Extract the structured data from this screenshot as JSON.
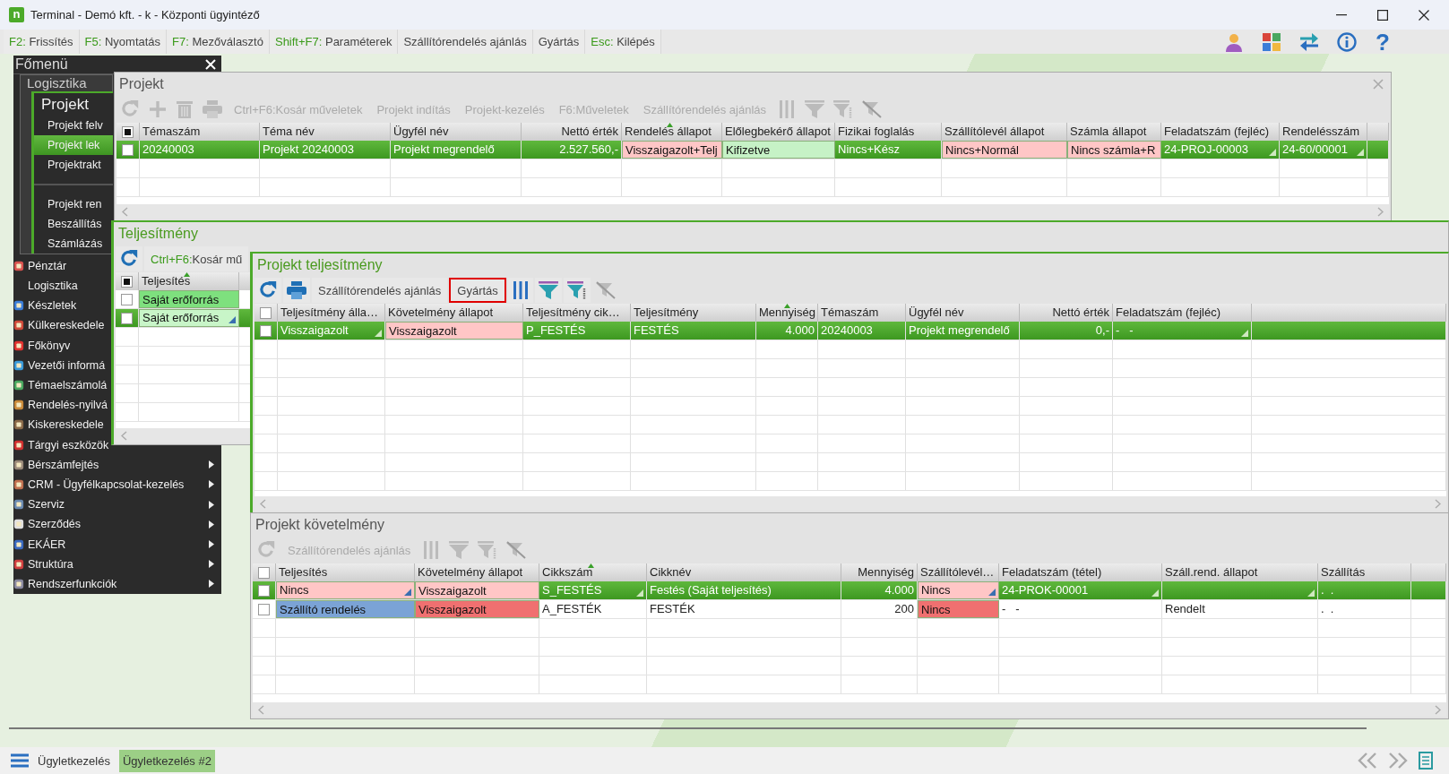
{
  "window": {
    "logo": "n",
    "title": "Terminal - Demó kft. - k - Központi ügyintéző"
  },
  "function_bar": [
    {
      "key": "F2:",
      "label": "Frissítés"
    },
    {
      "key": "F5:",
      "label": "Nyomtatás"
    },
    {
      "key": "F7:",
      "label": "Mezőválasztó"
    },
    {
      "key": "Shift+F7:",
      "label": "Paraméterek"
    },
    {
      "label": "Szállítórendelés ajánlás"
    },
    {
      "label": "Gyártás"
    },
    {
      "key": "Esc:",
      "label": "Kilépés"
    }
  ],
  "help_button": "?",
  "main_menu": {
    "title": "Főmenü",
    "submenu": {
      "title": "Logisztika",
      "group": "Projekt",
      "sections": [
        [
          {
            "label": "Projekt felv",
            "selected": false
          },
          {
            "label": "Projekt lek",
            "selected": true
          },
          {
            "label": "Projektrakt",
            "selected": false
          }
        ],
        [
          {
            "label": "Projekt ren",
            "selected": false
          },
          {
            "label": "Beszállítás",
            "selected": false
          },
          {
            "label": "Számlázás",
            "selected": false
          }
        ]
      ]
    },
    "items": [
      {
        "label": "Pénztár",
        "icon": true,
        "submenu": false
      },
      {
        "label": "Logisztika",
        "icon": false,
        "submenu": false
      },
      {
        "label": "Készletek",
        "icon": true,
        "submenu": false
      },
      {
        "label": "Külkereskedele",
        "icon": true,
        "submenu": false
      },
      {
        "label": "Főkönyv",
        "icon": true,
        "submenu": false
      },
      {
        "label": "Vezetői informá",
        "icon": true,
        "submenu": false
      },
      {
        "label": "Témaelszámolá",
        "icon": true,
        "submenu": false
      },
      {
        "label": "Rendelés-nyilvá",
        "icon": true,
        "submenu": false
      },
      {
        "label": "Kiskereskedele",
        "icon": true,
        "submenu": false
      },
      {
        "label": "Tárgyi eszközök",
        "icon": true,
        "submenu": false
      },
      {
        "label": "Bérszámfejtés",
        "icon": true,
        "submenu": true
      },
      {
        "label": "CRM - Ügyfélkapcsolat-kezelés",
        "icon": true,
        "submenu": true
      },
      {
        "label": "Szerviz",
        "icon": true,
        "submenu": true
      },
      {
        "label": "Szerződés",
        "icon": true,
        "submenu": true
      },
      {
        "label": "EKÁER",
        "icon": true,
        "submenu": true
      },
      {
        "label": "Struktúra",
        "icon": true,
        "submenu": true
      },
      {
        "label": "Rendszerfunkciók",
        "icon": true,
        "submenu": true
      }
    ]
  },
  "windows": [
    {
      "title": "Projekt",
      "active": false,
      "closable": true,
      "toolbar": [
        {
          "kind": "refresh",
          "disabled": true
        },
        {
          "kind": "add",
          "disabled": true
        },
        {
          "kind": "delete",
          "disabled": true
        },
        {
          "kind": "print",
          "disabled": true
        },
        {
          "kind": "text",
          "key": "Ctrl+F6:",
          "label": "Kosár műveletek",
          "disabled": true
        },
        {
          "kind": "text",
          "label": "Projekt indítás",
          "disabled": true
        },
        {
          "kind": "text",
          "label": "Projekt-kezelés",
          "disabled": true
        },
        {
          "kind": "text",
          "key": "F6:",
          "label": "Műveletek",
          "disabled": true
        },
        {
          "kind": "text",
          "label": "Szállítórendelés ajánlás",
          "disabled": true
        },
        {
          "kind": "columns",
          "disabled": true
        },
        {
          "kind": "filter",
          "disabled": true
        },
        {
          "kind": "filter_edit",
          "disabled": true
        },
        {
          "kind": "filter_clear",
          "disabled": true
        }
      ],
      "table": {
        "header_checked": true,
        "columns": [
          {
            "label": "Témaszám",
            "sorted": false
          },
          {
            "label": "Téma név",
            "sorted": false
          },
          {
            "label": "Ügyfél név",
            "sorted": false
          },
          {
            "label": "Nettó érték",
            "sorted": false
          },
          {
            "label": "Rendelés állapot",
            "sorted": true
          },
          {
            "label": "Előlegbekérő állapot",
            "sorted": false
          },
          {
            "label": "Fizikai foglalás",
            "sorted": false
          },
          {
            "label": "Szállítólevél állapot",
            "sorted": false
          },
          {
            "label": "Számla állapot",
            "sorted": false
          },
          {
            "label": "Feladatszám (fejléc)",
            "sorted": false
          },
          {
            "label": "Rendelésszám",
            "sorted": false
          }
        ],
        "rows": [
          {
            "selected": true,
            "checked": false,
            "cells": [
              {
                "text": "20240003"
              },
              {
                "text": "Projekt 20240003"
              },
              {
                "text": "Projekt megrendelő"
              },
              {
                "text": "2.527.560,-"
              },
              {
                "text": "Visszaigazolt+Telj",
                "color": "#ffc6c6"
              },
              {
                "text": "Kifizetve",
                "color": "#c6f2c6"
              },
              {
                "text": "Nincs+Kész"
              },
              {
                "text": "Nincs+Normál",
                "color": "#ffc6c6"
              },
              {
                "text": "Nincs számla+R",
                "color": "#ffc6c6"
              },
              {
                "text": "24-PROJ-00003",
                "dropdown": true
              },
              {
                "text": "24-60/00001",
                "dropdown": true
              }
            ]
          }
        ]
      }
    },
    {
      "title": "Teljesítmény",
      "active": true,
      "closable": false,
      "toolbar": [
        {
          "kind": "refresh",
          "disabled": false
        },
        {
          "kind": "text",
          "key": "Ctrl+F6:",
          "label": "Kosár mű",
          "disabled": false
        }
      ],
      "table": {
        "header_checked": true,
        "columns": [
          {
            "label": "Teljesítés",
            "sorted": true
          }
        ],
        "rows": [
          {
            "selected": false,
            "checked": false,
            "cells": [
              {
                "text": "Saját erőforrás",
                "color": "#7ee07e"
              }
            ]
          },
          {
            "selected": true,
            "checked": false,
            "cells": [
              {
                "text": "Saját erőforrás",
                "color": "#c8f5c8",
                "dropdown": true
              }
            ]
          }
        ]
      }
    },
    {
      "title": "Projekt teljesítmény",
      "active": true,
      "closable": false,
      "toolbar": [
        {
          "kind": "refresh",
          "disabled": false
        },
        {
          "kind": "print",
          "disabled": false
        },
        {
          "kind": "text",
          "label": "Szállítórendelés ajánlás",
          "disabled": false
        },
        {
          "kind": "text",
          "label": "Gyártás",
          "disabled": false,
          "highlighted": true
        },
        {
          "kind": "columns",
          "disabled": false
        },
        {
          "kind": "filter",
          "disabled": false
        },
        {
          "kind": "filter_edit",
          "disabled": false
        },
        {
          "kind": "filter_clear",
          "disabled": true
        }
      ],
      "table": {
        "header_checked": false,
        "columns": [
          {
            "label": "Teljesítmény álla…",
            "sorted": false
          },
          {
            "label": "Követelmény állapot",
            "sorted": false
          },
          {
            "label": "Teljesítmény cik…",
            "sorted": false
          },
          {
            "label": "Teljesítmény",
            "sorted": false
          },
          {
            "label": "Mennyiség",
            "sorted": true
          },
          {
            "label": "Témaszám",
            "sorted": false
          },
          {
            "label": "Ügyfél név",
            "sorted": false
          },
          {
            "label": "Nettó érték",
            "sorted": false
          },
          {
            "label": "Feladatszám (fejléc)",
            "sorted": false
          }
        ],
        "rows": [
          {
            "selected": true,
            "checked": false,
            "cells": [
              {
                "text": "Visszaigazolt",
                "dropdown": true
              },
              {
                "text": "Visszaigazolt",
                "color": "#ffc6c6"
              },
              {
                "text": "P_FESTÉS"
              },
              {
                "text": "FESTÉS"
              },
              {
                "text": "4.000"
              },
              {
                "text": "20240003"
              },
              {
                "text": "Projekt megrendelő"
              },
              {
                "text": "0,-"
              },
              {
                "text": "-   -",
                "dropdown": true
              }
            ]
          }
        ]
      }
    },
    {
      "title": "Projekt követelmény",
      "active": false,
      "closable": false,
      "toolbar": [
        {
          "kind": "refresh",
          "disabled": true
        },
        {
          "kind": "text",
          "label": "Szállítórendelés ajánlás",
          "disabled": true
        },
        {
          "kind": "columns",
          "disabled": true
        },
        {
          "kind": "filter",
          "disabled": true
        },
        {
          "kind": "filter_edit",
          "disabled": true
        },
        {
          "kind": "filter_clear",
          "disabled": true
        }
      ],
      "table": {
        "header_checked": false,
        "columns": [
          {
            "label": "Teljesítés",
            "sorted": false
          },
          {
            "label": "Követelmény állapot",
            "sorted": false
          },
          {
            "label": "Cikkszám",
            "sorted": true
          },
          {
            "label": "Cikknév",
            "sorted": false
          },
          {
            "label": "Mennyiség",
            "sorted": false
          },
          {
            "label": "Szállítólevél…",
            "sorted": false
          },
          {
            "label": "Feladatszám (tétel)",
            "sorted": false
          },
          {
            "label": "Száll.rend. állapot",
            "sorted": false
          },
          {
            "label": "Szállítás",
            "sorted": false
          }
        ],
        "rows": [
          {
            "selected": true,
            "checked": false,
            "cells": [
              {
                "text": "Nincs",
                "color": "#ffc6c6",
                "dropdown": true
              },
              {
                "text": "Visszaigazolt",
                "color": "#ffc6c6"
              },
              {
                "text": "S_FESTÉS",
                "dropdown": true
              },
              {
                "text": "Festés (Saját teljesítés)"
              },
              {
                "text": "4.000"
              },
              {
                "text": "Nincs",
                "color": "#ffc6c6",
                "dropdown": true
              },
              {
                "text": "24-PROK-00001",
                "dropdown": true
              },
              {
                "dropdown": true
              },
              {
                "text": ".  ."
              }
            ]
          },
          {
            "selected": false,
            "checked": false,
            "cells": [
              {
                "text": "Szállító rendelés",
                "color": "#7ba3d6"
              },
              {
                "text": "Visszaigazolt",
                "color": "#f07070"
              },
              {
                "text": "A_FESTÉK"
              },
              {
                "text": "FESTÉK"
              },
              {
                "text": "200"
              },
              {
                "text": "Nincs",
                "color": "#f07070"
              },
              {
                "text": "-   -"
              },
              {
                "text": "Rendelt"
              },
              {
                "text": ".  ."
              }
            ]
          }
        ]
      }
    }
  ],
  "taskbar": {
    "tabs": [
      {
        "label": "Ügyletkezelés",
        "selected": false
      },
      {
        "label": "Ügyletkezelés #2",
        "selected": true
      }
    ]
  }
}
